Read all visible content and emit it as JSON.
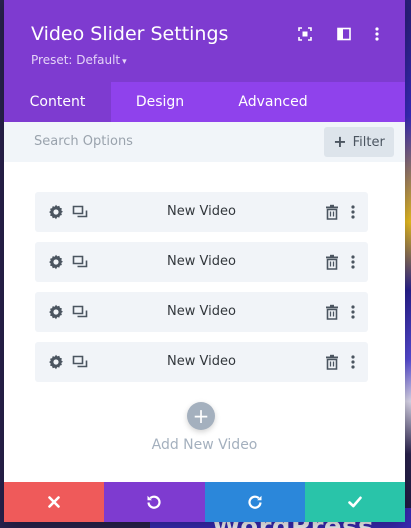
{
  "modal": {
    "title": "Video Slider Settings",
    "preset_label": "Preset: Default",
    "preset_caret": "▾"
  },
  "tabs": [
    {
      "label": "Content",
      "active": true
    },
    {
      "label": "Design",
      "active": false
    },
    {
      "label": "Advanced",
      "active": false
    }
  ],
  "search": {
    "placeholder": "Search Options",
    "filter_label": "Filter",
    "filter_icon": "+"
  },
  "items": [
    {
      "label": "New Video"
    },
    {
      "label": "New Video"
    },
    {
      "label": "New Video"
    },
    {
      "label": "New Video"
    }
  ],
  "add": {
    "icon": "+",
    "label": "Add New Video"
  },
  "background": {
    "partial_text": "WordPress"
  },
  "colors": {
    "header": "#7e3bd0",
    "tabs": "#8f42ec",
    "cancel": "#ef5a5a",
    "undo": "#7e3bd0",
    "redo": "#2b87da",
    "save": "#29c4a9"
  }
}
